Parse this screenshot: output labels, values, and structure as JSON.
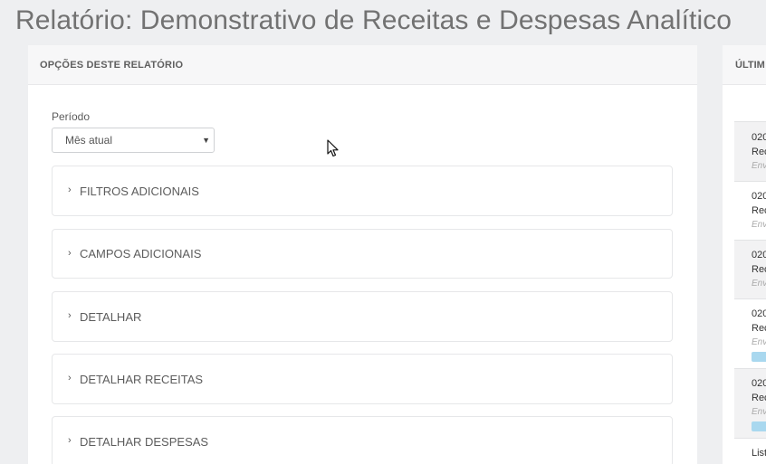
{
  "page": {
    "title": "Relatório: Demonstrativo de Receitas e Despesas Analítico"
  },
  "options_panel": {
    "header": "OPÇÕES DESTE RELATÓRIO",
    "period_label": "Período",
    "period_value": "Mês atual",
    "sections": [
      {
        "label": "FILTROS ADICIONAIS"
      },
      {
        "label": "CAMPOS ADICIONAIS"
      },
      {
        "label": "DETALHAR"
      },
      {
        "label": "DETALHAR RECEITAS"
      },
      {
        "label": "DETALHAR DESPESAS"
      }
    ]
  },
  "recent_panel": {
    "header": "ÚLTIM",
    "items": [
      {
        "line1": "020",
        "line2": "Rec",
        "line3": "Env"
      },
      {
        "line1": "020",
        "line2": "Rec",
        "line3": "Env"
      },
      {
        "line1": "020",
        "line2": "Rec",
        "line3": "Env"
      },
      {
        "line1": "020",
        "line2": "Rec",
        "line3": "Env"
      },
      {
        "line1": "020",
        "line2": "Rec",
        "line3": "Env"
      }
    ],
    "footer_link": "List"
  }
}
